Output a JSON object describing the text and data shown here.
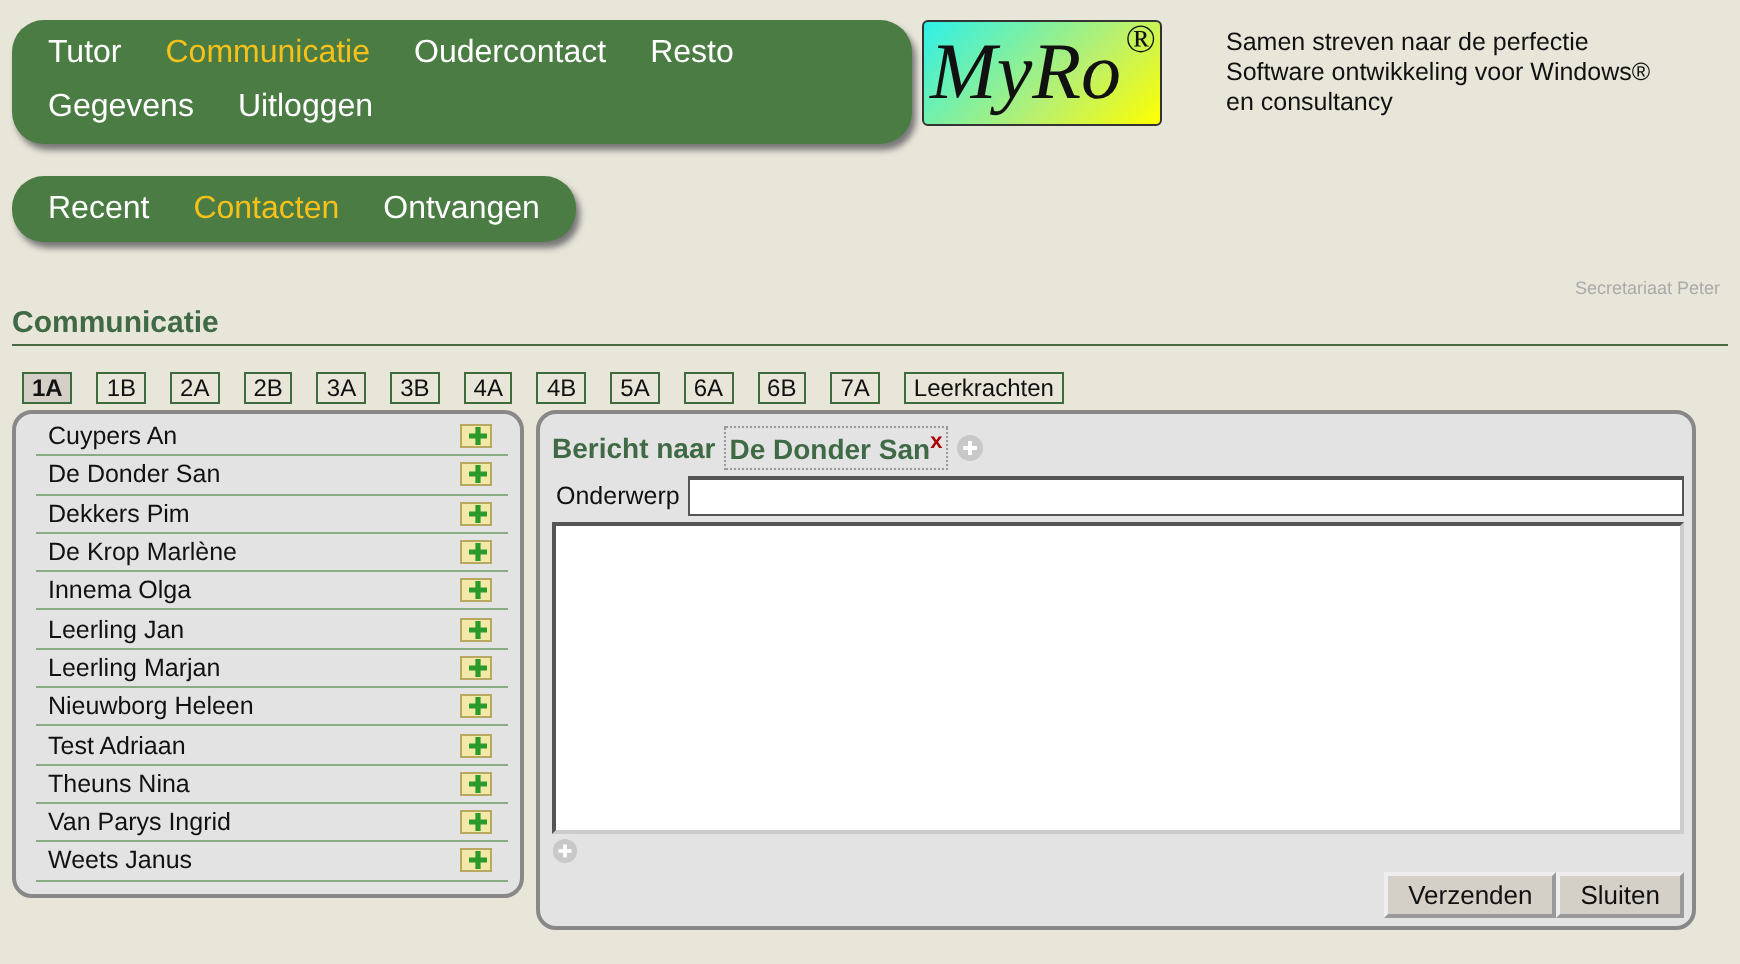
{
  "main_menu": [
    {
      "label": "Tutor",
      "selected": false
    },
    {
      "label": "Communicatie",
      "selected": true
    },
    {
      "label": "Oudercontact",
      "selected": false
    },
    {
      "label": "Resto",
      "selected": false
    },
    {
      "label": "Gegevens",
      "selected": false
    },
    {
      "label": "Uitloggen",
      "selected": false
    }
  ],
  "logo": {
    "text": "MyRo",
    "mark": "®"
  },
  "tagline": [
    "Samen streven naar de perfectie",
    "Software ontwikkeling voor Windows® en consultancy"
  ],
  "sub_menu": [
    {
      "label": "Recent",
      "selected": false
    },
    {
      "label": "Contacten",
      "selected": true
    },
    {
      "label": "Ontvangen",
      "selected": false
    }
  ],
  "user": "Secretariaat Peter",
  "heading": "Communicatie",
  "class_tabs": [
    {
      "label": "1A",
      "selected": true
    },
    {
      "label": "1B",
      "selected": false
    },
    {
      "label": "2A",
      "selected": false
    },
    {
      "label": "2B",
      "selected": false
    },
    {
      "label": "3A",
      "selected": false
    },
    {
      "label": "3B",
      "selected": false
    },
    {
      "label": "4A",
      "selected": false
    },
    {
      "label": "4B",
      "selected": false
    },
    {
      "label": "5A",
      "selected": false
    },
    {
      "label": "6A",
      "selected": false
    },
    {
      "label": "6B",
      "selected": false
    },
    {
      "label": "7A",
      "selected": false
    },
    {
      "label": "Leerkrachten",
      "selected": false
    }
  ],
  "contacts": [
    "Cuypers An",
    "De Donder San",
    "Dekkers Pim",
    "De Krop Marlène",
    "Innema Olga",
    "Leerling Jan",
    "Leerling Marjan",
    "Nieuwborg Heleen",
    "Test Adriaan",
    "Theuns Nina",
    "Van Parys Ingrid",
    "Weets Janus"
  ],
  "message": {
    "to_label": "Bericht naar",
    "recipients": [
      {
        "name": "De Donder San",
        "remove": "x"
      }
    ],
    "subject_label": "Onderwerp",
    "buttons": [
      "Verzenden",
      "Sluiten"
    ]
  }
}
